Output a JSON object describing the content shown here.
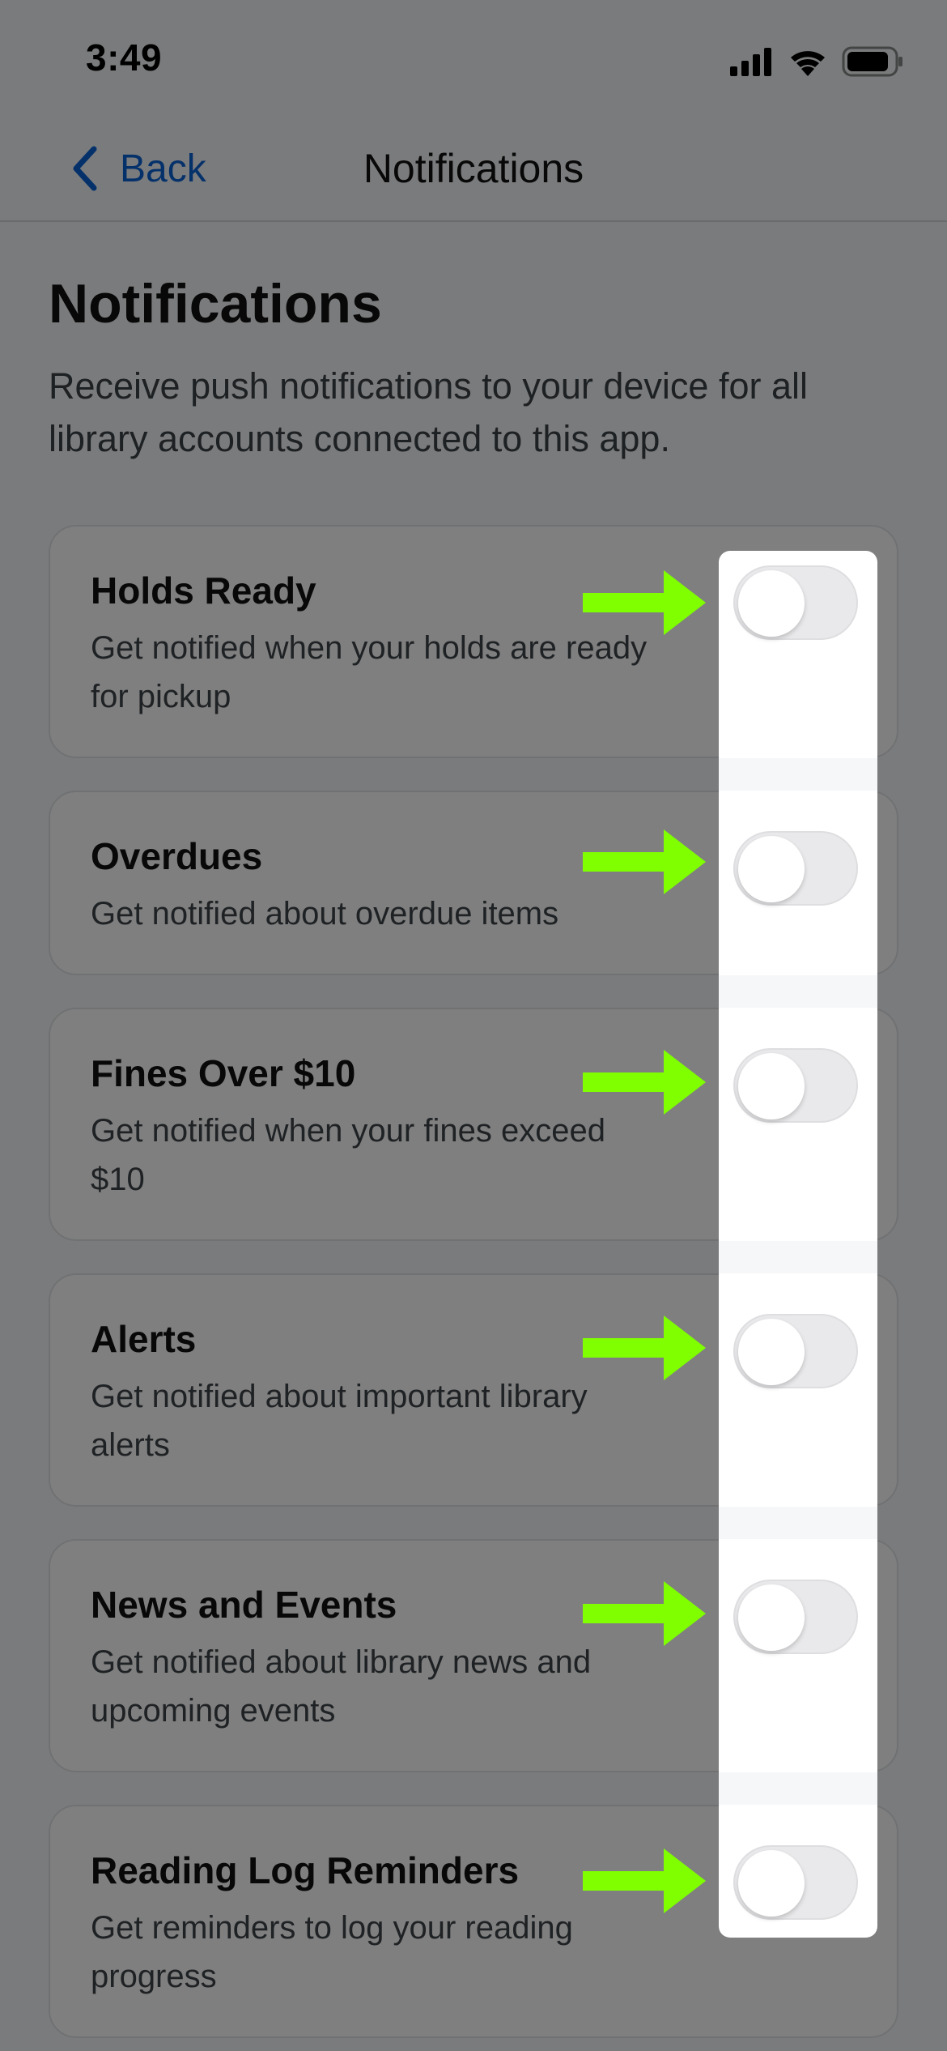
{
  "status_bar": {
    "time": "3:49",
    "icons": [
      "cellular-signal-icon",
      "wifi-icon",
      "battery-icon"
    ]
  },
  "nav": {
    "back_label": "Back",
    "title": "Notifications"
  },
  "page": {
    "title": "Notifications",
    "description": "Receive push notifications to your device for all library accounts connected to this app."
  },
  "settings": [
    {
      "title": "Holds Ready",
      "description": "Get notified when your holds are ready for pickup",
      "enabled": false
    },
    {
      "title": "Overdues",
      "description": "Get notified about overdue items",
      "enabled": false
    },
    {
      "title": "Fines Over $10",
      "description": "Get notified when your fines exceed $10",
      "enabled": false
    },
    {
      "title": "Alerts",
      "description": "Get notified about important library alerts",
      "enabled": false
    },
    {
      "title": "News and Events",
      "description": "Get notified about library news and upcoming events",
      "enabled": false
    },
    {
      "title": "Reading Log Reminders",
      "description": "Get reminders to log your reading progress",
      "enabled": false
    }
  ],
  "colors": {
    "accent": "#0a63d6",
    "annotation_arrow": "#7fff00",
    "toggle_off": "#e9e9eb"
  }
}
